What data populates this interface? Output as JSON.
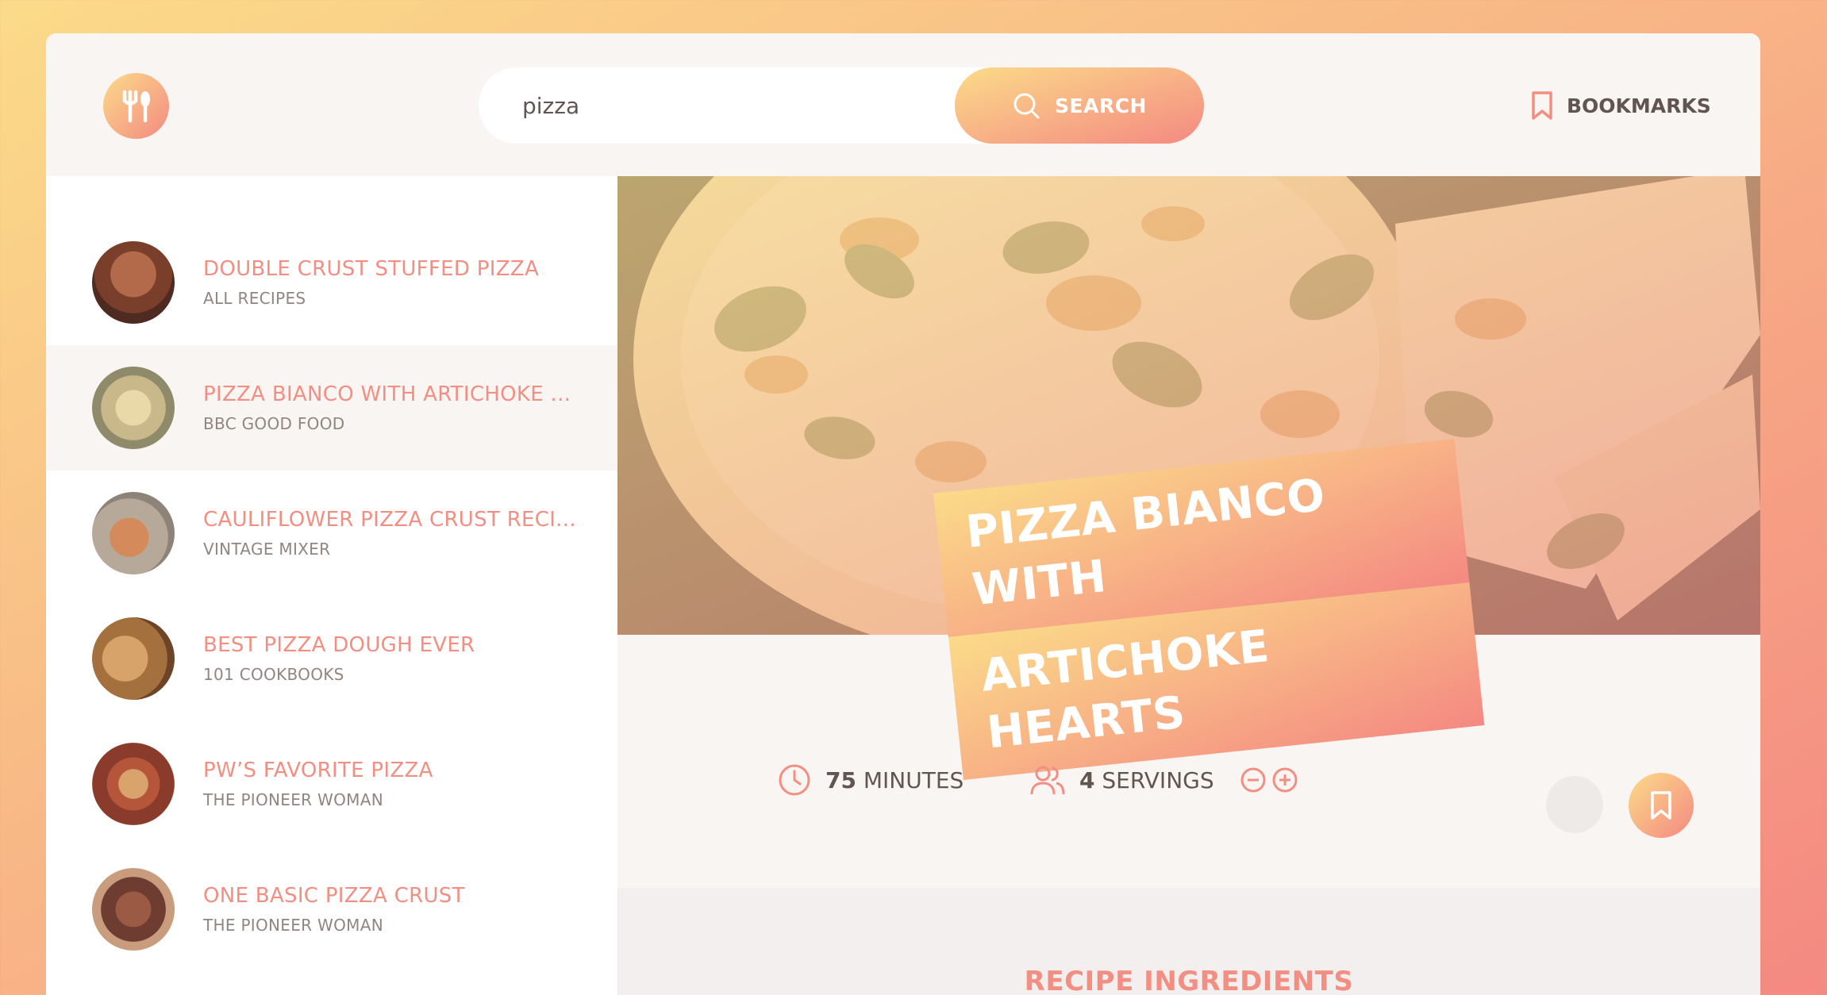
{
  "header": {
    "search_value": "pizza",
    "search_button_label": "SEARCH",
    "bookmarks_label": "BOOKMARKS"
  },
  "results": [
    {
      "title": "DOUBLE CRUST STUFFED PIZZA",
      "publisher": "ALL RECIPES",
      "active": false
    },
    {
      "title": "PIZZA BIANCO WITH ARTICHOKE ...",
      "publisher": "BBC GOOD FOOD",
      "active": true
    },
    {
      "title": "CAULIFLOWER PIZZA CRUST RECI...",
      "publisher": "VINTAGE MIXER",
      "active": false
    },
    {
      "title": "BEST PIZZA DOUGH EVER",
      "publisher": "101 COOKBOOKS",
      "active": false
    },
    {
      "title": "PW’S FAVORITE PIZZA",
      "publisher": "THE PIONEER WOMAN",
      "active": false
    },
    {
      "title": "ONE BASIC PIZZA CRUST",
      "publisher": "THE PIONEER WOMAN",
      "active": false
    }
  ],
  "recipe": {
    "title_line1": "PIZZA BIANCO WITH",
    "title_line2": "ARTICHOKE HEARTS",
    "minutes_value": "75",
    "minutes_label": "MINUTES",
    "servings_value": "4",
    "servings_label": "SERVINGS",
    "ingredients_heading": "RECIPE INGREDIENTS"
  },
  "colors": {
    "accent": "#f38e82",
    "gradient_start": "#fbdb89",
    "gradient_end": "#f48982",
    "text": "#615551"
  },
  "icons": [
    "fork-knife-icon",
    "search-icon",
    "bookmark-icon",
    "clock-icon",
    "users-icon",
    "minus-circle-icon",
    "plus-circle-icon"
  ]
}
